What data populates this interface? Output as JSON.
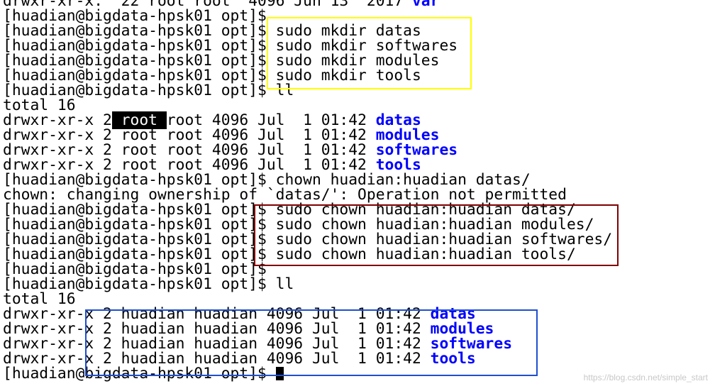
{
  "terminal": {
    "lines": [
      {
        "text": "drwxr-xr-x.  22 root root  4096 Jun 13  2017 ",
        "dir": "var"
      },
      {
        "text": "[huadian@bigdata-hpsk01 opt]$"
      },
      {
        "text": "[huadian@bigdata-hpsk01 opt]$ sudo mkdir datas"
      },
      {
        "text": "[huadian@bigdata-hpsk01 opt]$ sudo mkdir softwares"
      },
      {
        "text": "[huadian@bigdata-hpsk01 opt]$ sudo mkdir modules"
      },
      {
        "text": "[huadian@bigdata-hpsk01 opt]$ sudo mkdir tools"
      },
      {
        "text": "[huadian@bigdata-hpsk01 opt]$ ll"
      },
      {
        "text": "total 16"
      },
      {
        "pre": "drwxr-xr-x 2",
        "hl": " root ",
        "text": "root 4096 Jul  1 01:42 ",
        "dir": "datas"
      },
      {
        "text": "drwxr-xr-x 2 root root 4096 Jul  1 01:42 ",
        "dir": "modules"
      },
      {
        "text": "drwxr-xr-x 2 root root 4096 Jul  1 01:42 ",
        "dir": "softwares"
      },
      {
        "text": "drwxr-xr-x 2 root root 4096 Jul  1 01:42 ",
        "dir": "tools"
      },
      {
        "text": "[huadian@bigdata-hpsk01 opt]$ chown huadian:huadian datas/"
      },
      {
        "text": "chown: changing ownership of `datas/': Operation not permitted"
      },
      {
        "text": "[huadian@bigdata-hpsk01 opt]$ sudo chown huadian:huadian datas/"
      },
      {
        "text": "[huadian@bigdata-hpsk01 opt]$ sudo chown huadian:huadian modules/"
      },
      {
        "text": "[huadian@bigdata-hpsk01 opt]$ sudo chown huadian:huadian softwares/"
      },
      {
        "text": "[huadian@bigdata-hpsk01 opt]$ sudo chown huadian:huadian tools/"
      },
      {
        "text": "[huadian@bigdata-hpsk01 opt]$"
      },
      {
        "text": "[huadian@bigdata-hpsk01 opt]$ ll"
      },
      {
        "text": "total 16"
      },
      {
        "text": "drwxr-xr-x 2 huadian huadian 4096 Jul  1 01:42 ",
        "dir": "datas"
      },
      {
        "text": "drwxr-xr-x 2 huadian huadian 4096 Jul  1 01:42 ",
        "dir": "modules"
      },
      {
        "text": "drwxr-xr-x 2 huadian huadian 4096 Jul  1 01:42 ",
        "dir": "softwares"
      },
      {
        "text": "drwxr-xr-x 2 huadian huadian 4096 Jul  1 01:42 ",
        "dir": "tools"
      },
      {
        "text": "[huadian@bigdata-hpsk01 opt]$ ",
        "cursor": true
      }
    ]
  },
  "watermark": "https://blog.csdn.net/simple_start",
  "colors": {
    "background": "#ffffff",
    "text": "#000000",
    "directory": "#0000ff",
    "highlight_bg": "#000000",
    "highlight_fg": "#ffffff",
    "box_yellow": "#ffff00",
    "box_red": "#800000",
    "box_blue": "#1f4fd1"
  }
}
